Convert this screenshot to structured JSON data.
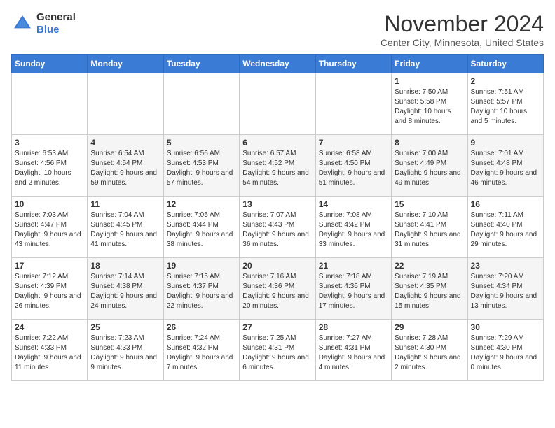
{
  "header": {
    "logo_line1": "General",
    "logo_line2": "Blue",
    "month_title": "November 2024",
    "location": "Center City, Minnesota, United States"
  },
  "weekdays": [
    "Sunday",
    "Monday",
    "Tuesday",
    "Wednesday",
    "Thursday",
    "Friday",
    "Saturday"
  ],
  "weeks": [
    [
      {
        "day": "",
        "info": ""
      },
      {
        "day": "",
        "info": ""
      },
      {
        "day": "",
        "info": ""
      },
      {
        "day": "",
        "info": ""
      },
      {
        "day": "",
        "info": ""
      },
      {
        "day": "1",
        "info": "Sunrise: 7:50 AM\nSunset: 5:58 PM\nDaylight: 10 hours and 8 minutes."
      },
      {
        "day": "2",
        "info": "Sunrise: 7:51 AM\nSunset: 5:57 PM\nDaylight: 10 hours and 5 minutes."
      }
    ],
    [
      {
        "day": "3",
        "info": "Sunrise: 6:53 AM\nSunset: 4:56 PM\nDaylight: 10 hours and 2 minutes."
      },
      {
        "day": "4",
        "info": "Sunrise: 6:54 AM\nSunset: 4:54 PM\nDaylight: 9 hours and 59 minutes."
      },
      {
        "day": "5",
        "info": "Sunrise: 6:56 AM\nSunset: 4:53 PM\nDaylight: 9 hours and 57 minutes."
      },
      {
        "day": "6",
        "info": "Sunrise: 6:57 AM\nSunset: 4:52 PM\nDaylight: 9 hours and 54 minutes."
      },
      {
        "day": "7",
        "info": "Sunrise: 6:58 AM\nSunset: 4:50 PM\nDaylight: 9 hours and 51 minutes."
      },
      {
        "day": "8",
        "info": "Sunrise: 7:00 AM\nSunset: 4:49 PM\nDaylight: 9 hours and 49 minutes."
      },
      {
        "day": "9",
        "info": "Sunrise: 7:01 AM\nSunset: 4:48 PM\nDaylight: 9 hours and 46 minutes."
      }
    ],
    [
      {
        "day": "10",
        "info": "Sunrise: 7:03 AM\nSunset: 4:47 PM\nDaylight: 9 hours and 43 minutes."
      },
      {
        "day": "11",
        "info": "Sunrise: 7:04 AM\nSunset: 4:45 PM\nDaylight: 9 hours and 41 minutes."
      },
      {
        "day": "12",
        "info": "Sunrise: 7:05 AM\nSunset: 4:44 PM\nDaylight: 9 hours and 38 minutes."
      },
      {
        "day": "13",
        "info": "Sunrise: 7:07 AM\nSunset: 4:43 PM\nDaylight: 9 hours and 36 minutes."
      },
      {
        "day": "14",
        "info": "Sunrise: 7:08 AM\nSunset: 4:42 PM\nDaylight: 9 hours and 33 minutes."
      },
      {
        "day": "15",
        "info": "Sunrise: 7:10 AM\nSunset: 4:41 PM\nDaylight: 9 hours and 31 minutes."
      },
      {
        "day": "16",
        "info": "Sunrise: 7:11 AM\nSunset: 4:40 PM\nDaylight: 9 hours and 29 minutes."
      }
    ],
    [
      {
        "day": "17",
        "info": "Sunrise: 7:12 AM\nSunset: 4:39 PM\nDaylight: 9 hours and 26 minutes."
      },
      {
        "day": "18",
        "info": "Sunrise: 7:14 AM\nSunset: 4:38 PM\nDaylight: 9 hours and 24 minutes."
      },
      {
        "day": "19",
        "info": "Sunrise: 7:15 AM\nSunset: 4:37 PM\nDaylight: 9 hours and 22 minutes."
      },
      {
        "day": "20",
        "info": "Sunrise: 7:16 AM\nSunset: 4:36 PM\nDaylight: 9 hours and 20 minutes."
      },
      {
        "day": "21",
        "info": "Sunrise: 7:18 AM\nSunset: 4:36 PM\nDaylight: 9 hours and 17 minutes."
      },
      {
        "day": "22",
        "info": "Sunrise: 7:19 AM\nSunset: 4:35 PM\nDaylight: 9 hours and 15 minutes."
      },
      {
        "day": "23",
        "info": "Sunrise: 7:20 AM\nSunset: 4:34 PM\nDaylight: 9 hours and 13 minutes."
      }
    ],
    [
      {
        "day": "24",
        "info": "Sunrise: 7:22 AM\nSunset: 4:33 PM\nDaylight: 9 hours and 11 minutes."
      },
      {
        "day": "25",
        "info": "Sunrise: 7:23 AM\nSunset: 4:33 PM\nDaylight: 9 hours and 9 minutes."
      },
      {
        "day": "26",
        "info": "Sunrise: 7:24 AM\nSunset: 4:32 PM\nDaylight: 9 hours and 7 minutes."
      },
      {
        "day": "27",
        "info": "Sunrise: 7:25 AM\nSunset: 4:31 PM\nDaylight: 9 hours and 6 minutes."
      },
      {
        "day": "28",
        "info": "Sunrise: 7:27 AM\nSunset: 4:31 PM\nDaylight: 9 hours and 4 minutes."
      },
      {
        "day": "29",
        "info": "Sunrise: 7:28 AM\nSunset: 4:30 PM\nDaylight: 9 hours and 2 minutes."
      },
      {
        "day": "30",
        "info": "Sunrise: 7:29 AM\nSunset: 4:30 PM\nDaylight: 9 hours and 0 minutes."
      }
    ]
  ]
}
